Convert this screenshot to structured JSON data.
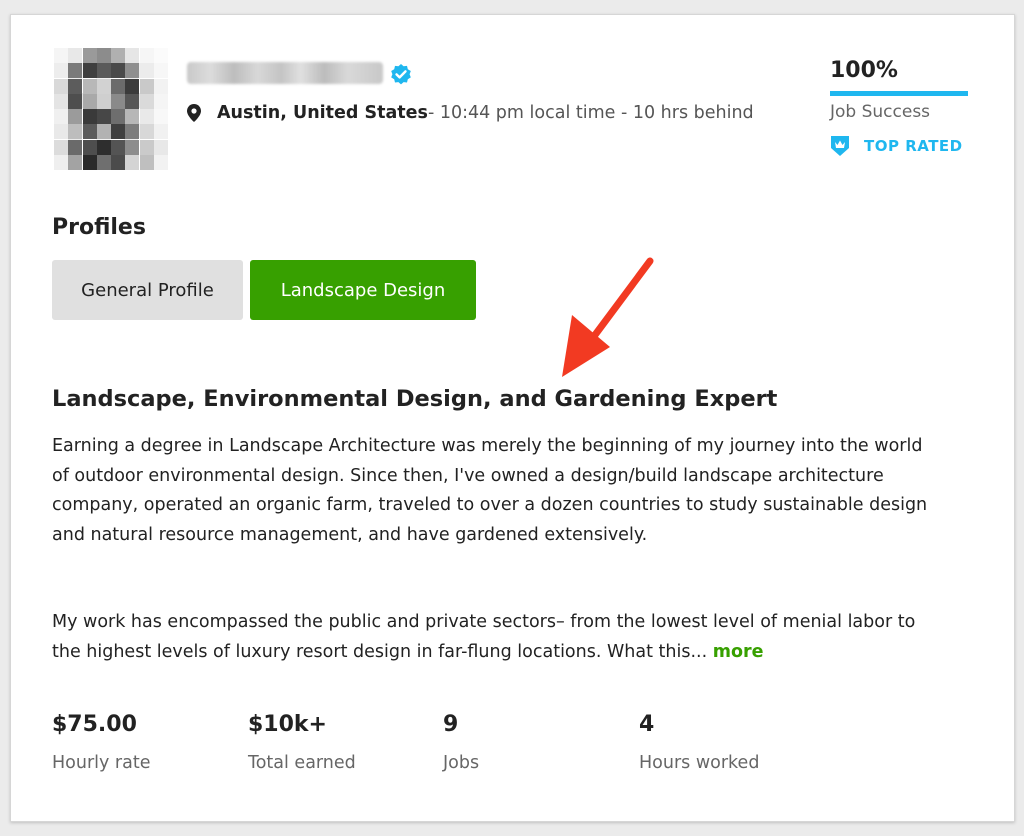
{
  "freelancer": {
    "location_city": "Austin, United States",
    "location_detail": " - 10:44 pm local time - 10 hrs behind"
  },
  "job_success": {
    "percent_text": "100%",
    "percent_value": 100,
    "label": "Job Success",
    "badge_label": "TOP RATED"
  },
  "profiles": {
    "heading": "Profiles",
    "tabs": [
      {
        "label": "General Profile",
        "active": false
      },
      {
        "label": "Landscape Design",
        "active": true
      }
    ]
  },
  "overview": {
    "title": "Landscape, Environmental Design, and Gardening Expert",
    "paragraph1": "Earning a degree in Landscape Architecture was merely the beginning of my journey into the world of outdoor environmental design. Since then, I've owned a design/build landscape architecture company, operated an organic farm, traveled to over a dozen countries to study sustainable design and natural resource management, and have gardened extensively.",
    "paragraph2": "My work has encompassed the public and private sectors– from the lowest level of menial labor to the highest levels of luxury resort design in far-flung locations. What this...",
    "more_label": "more"
  },
  "stats": [
    {
      "value": "$75.00",
      "label": "Hourly rate"
    },
    {
      "value": "$10k+",
      "label": "Total earned"
    },
    {
      "value": "9",
      "label": "Jobs"
    },
    {
      "value": "4",
      "label": "Hours worked"
    }
  ],
  "icons": {
    "verified": "verified-check-icon",
    "location": "map-pin-icon",
    "top_rated": "top-rated-badge-icon",
    "annotation": "red-arrow-icon"
  },
  "colors": {
    "accent_blue": "#1fb7ef",
    "brand_green": "#37a000",
    "arrow_red": "#f23a22"
  }
}
